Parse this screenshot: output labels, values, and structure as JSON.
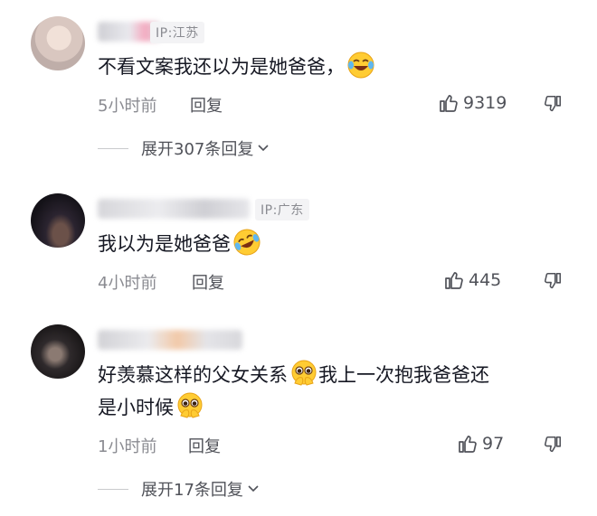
{
  "comments": [
    {
      "ip": "IP:江苏",
      "text": "不看文案我还以为是她爸爸，",
      "emoji": "crying-laughing-emoji",
      "time": "5小时前",
      "reply_label": "回复",
      "likes": "9319",
      "expand_label": "展开307条回复"
    },
    {
      "ip": "IP:广东",
      "text": "我以为是她爸爸",
      "emoji": "rolling-laughing-emoji",
      "time": "4小时前",
      "reply_label": "回复",
      "likes": "445"
    },
    {
      "ip": "",
      "text_line1": "好羡慕这样的父女关系",
      "text_line1b": "我上一次抱我爸爸还",
      "text_line2": "是小时候",
      "emoji": "pleading-hands-emoji",
      "time": "1小时前",
      "reply_label": "回复",
      "likes": "97",
      "expand_label": "展开17条回复"
    }
  ],
  "icons": {
    "like": "thumbs-up-icon",
    "dislike": "thumbs-down-icon",
    "expand": "chevron-down-icon"
  }
}
